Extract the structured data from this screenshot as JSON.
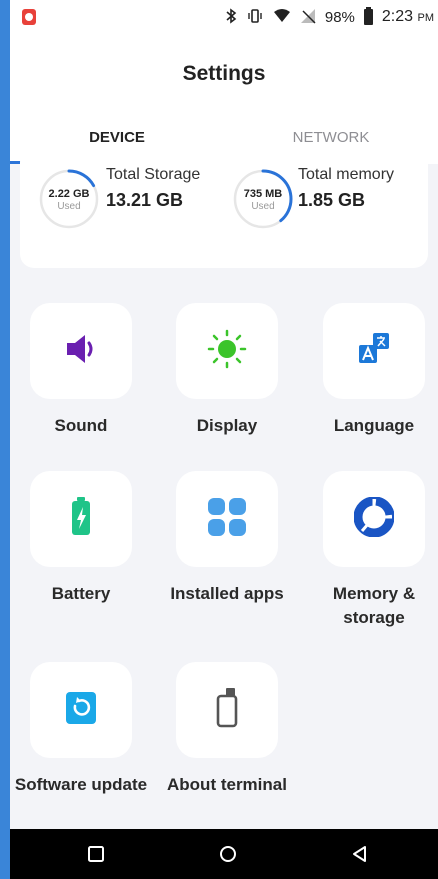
{
  "status_bar": {
    "battery_percent": "98%",
    "time": "2:23",
    "time_suffix": "PM",
    "icons": [
      "app-notification-icon",
      "bluetooth-icon",
      "vibrate-icon",
      "wifi-icon",
      "signal-icon",
      "battery-icon"
    ]
  },
  "header": {
    "title": "Settings",
    "tabs": [
      {
        "label": "DEVICE",
        "active": true
      },
      {
        "label": "NETWORK",
        "active": false
      }
    ]
  },
  "storage": {
    "storage_used_value": "2.22 GB",
    "storage_used_caption": "Used",
    "storage_label": "Total Storage",
    "storage_total": "13.21 GB",
    "storage_fraction": 0.17,
    "memory_used_value": "735 MB",
    "memory_used_caption": "Used",
    "memory_label": "Total memory",
    "memory_total": "1.85 GB",
    "memory_fraction": 0.39
  },
  "grid": [
    {
      "label": "Sound",
      "icon": "speaker-icon",
      "color": "#6a1fb0"
    },
    {
      "label": "Display",
      "icon": "brightness-icon",
      "color": "#3bc42a"
    },
    {
      "label": "Language",
      "icon": "translate-icon",
      "color": "#1c78d8"
    },
    {
      "label": "Battery",
      "icon": "battery-charging-icon",
      "color": "#1fc488"
    },
    {
      "label": "Installed apps",
      "icon": "apps-grid-icon",
      "color": "#4aa0e8"
    },
    {
      "label": "Memory & storage",
      "icon": "memory-pie-icon",
      "color": "#1a55c4"
    },
    {
      "label": "Software update",
      "icon": "update-icon",
      "color": "#1aa8e8"
    },
    {
      "label": "About terminal",
      "icon": "terminal-device-icon",
      "color": "#555555"
    }
  ],
  "colors": {
    "accent": "#2a73d8",
    "background": "#f3f4f8"
  }
}
